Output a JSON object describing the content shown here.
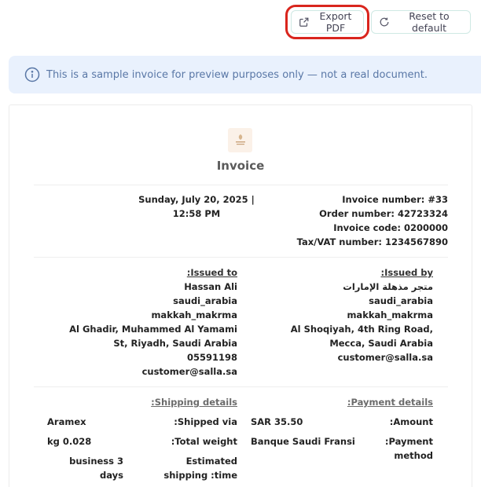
{
  "toolbar": {
    "export_label": "Export PDF",
    "reset_label": "Reset to default"
  },
  "notice": {
    "text": "This is a sample invoice for preview purposes only — not a real document."
  },
  "invoice": {
    "title": "Invoice",
    "date": "Sunday, July 20, 2025 | 12:58 PM",
    "invoice_number": "Invoice number: #33",
    "order_number": "Order number: 42723324",
    "invoice_code": "Invoice code: 0200000",
    "tax_number": "Tax/VAT number: 1234567890"
  },
  "issued_to": {
    "heading": ":Issued to",
    "name": "Hassan Ali",
    "country": "saudi_arabia",
    "city": "makkah_makrma",
    "address": "Al Ghadir, Muhammed Al Yamami St, Riyadh, Saudi Arabia",
    "phone": "05591198",
    "email": "customer@salla.sa"
  },
  "issued_by": {
    "heading": ":Issued by",
    "name": "متجر مذهلة الإمارات",
    "country": "saudi_arabia",
    "city": "makkah_makrma",
    "address": "Al Shoqiyah, 4th Ring Road, Mecca, Saudi Arabia",
    "email": "customer@salla.sa"
  },
  "shipping": {
    "heading": ":Shipping details",
    "shipped_via_label": ":Shipped via",
    "shipped_via_value": "Aramex",
    "weight_label": ":Total weight",
    "weight_value": "kg 0.028",
    "time_label": "Estimated shipping :time",
    "time_value": "business 3 days"
  },
  "payment": {
    "heading": ":Payment details",
    "amount_label": ":Amount",
    "amount_value": "SAR 35.50",
    "method_label": ":Payment method",
    "method_value": "Banque Saudi Fransi"
  },
  "colors": {
    "accent": "#d9251d",
    "notice_bg": "#e9f1fd",
    "notice_text": "#5977a6"
  }
}
